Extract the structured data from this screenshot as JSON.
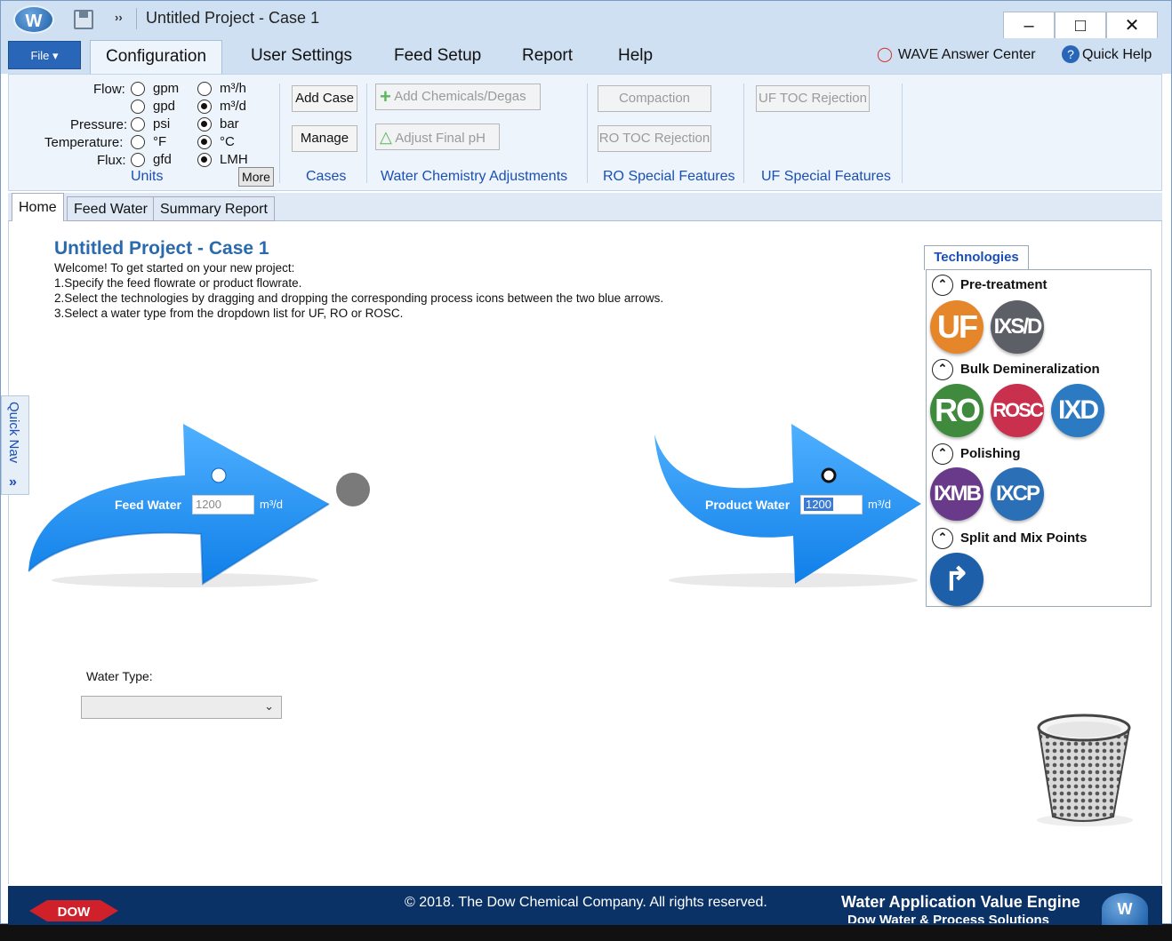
{
  "window": {
    "title": "Untitled Project - Case 1",
    "minimize": "–",
    "maximize": "□",
    "close": "✕",
    "logo": "W",
    "more": "››"
  },
  "ribbon_tabs": {
    "file": "File ▾",
    "tabs": [
      "Configuration",
      "User Settings",
      "Feed Setup",
      "Report",
      "Help"
    ],
    "answer_center": "WAVE Answer Center",
    "quick_help": "Quick Help"
  },
  "units": {
    "flow_label": "Flow:",
    "pressure_label": "Pressure:",
    "temperature_label": "Temperature:",
    "flux_label": "Flux:",
    "gpm": "gpm",
    "gpd": "gpd",
    "psi": "psi",
    "f": "°F",
    "gfd": "gfd",
    "m3h": "m³/h",
    "m3d": "m³/d",
    "bar": "bar",
    "c": "°C",
    "lmh": "LMH",
    "group_title": "Units",
    "more": "More"
  },
  "cases": {
    "add": "Add Case",
    "manage": "Manage",
    "group_title": "Cases"
  },
  "chemistry": {
    "add": "Add Chemicals/Degas",
    "adjust": "Adjust Final pH",
    "group_title": "Water Chemistry Adjustments"
  },
  "ro_special": {
    "compaction": "Compaction",
    "toc": "RO TOC Rejection",
    "group_title": "RO Special Features"
  },
  "uf_special": {
    "toc": "UF TOC Rejection",
    "group_title": "UF Special Features"
  },
  "page_tabs": [
    "Home",
    "Feed Water",
    "Summary Report"
  ],
  "home": {
    "title": "Untitled Project - Case 1",
    "line0": "Welcome! To get started on your new project:",
    "line1": "1.Specify the feed flowrate or product flowrate.",
    "line2": "2.Select the technologies by dragging and dropping the corresponding process icons between the two blue arrows.",
    "line3": "3.Select a water type from the dropdown list for UF, RO or ROSC.",
    "feed_label": "Feed Water",
    "feed_value": "1200",
    "feed_unit": "m³/d",
    "product_label": "Product Water",
    "product_value": "1200",
    "product_unit": "m³/d",
    "water_type_label": "Water Type:",
    "water_type_value": ""
  },
  "quick_nav": {
    "label": "Quick Nav",
    "arrow": "»"
  },
  "technologies": {
    "tab": "Technologies",
    "pretreatment": "Pre-treatment",
    "bulk": "Bulk Demineralization",
    "polishing": "Polishing",
    "split": "Split and Mix Points",
    "icons": {
      "uf": "UF",
      "ixsd": "IXS/D",
      "ro": "RO",
      "rosc": "ROSC",
      "ixd": "IXD",
      "ixmb": "IXMB",
      "ixcp": "IXCP",
      "split": "↱"
    },
    "colors": {
      "uf": "#e5862b",
      "ixsd": "#5c5f66",
      "ro": "#3f8a3c",
      "rosc": "#c9304e",
      "ixd": "#2c7bc2",
      "ixmb": "#6a3a8a",
      "ixcp": "#2b6fb6",
      "split": "#1d5fa8"
    }
  },
  "footer": {
    "dow": "DOW",
    "copyright": "© 2018. The Dow Chemical Company. All rights reserved.",
    "product": "Water Application Value Engine",
    "subtitle": "Dow Water & Process Solutions",
    "logo": "W"
  }
}
